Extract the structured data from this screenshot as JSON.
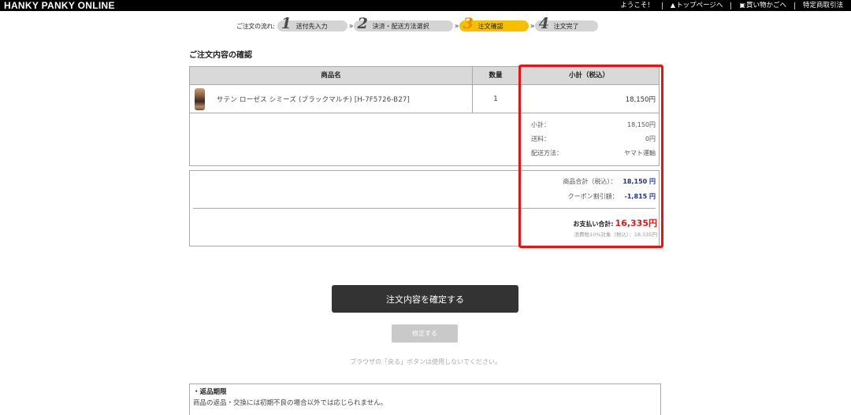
{
  "header": {
    "logo": "HANKY PANKY ONLINE",
    "nav": [
      {
        "label": "ようこそ！",
        "icon": ""
      },
      {
        "label": "トップページへ",
        "icon": "home-icon"
      },
      {
        "label": "買い物かごへ",
        "icon": "cart-icon"
      },
      {
        "label": "特定商取引法",
        "icon": ""
      }
    ]
  },
  "flow": {
    "label": "ご注文の流れ:",
    "steps": [
      {
        "num": "1",
        "label": "送付先入力",
        "active": false
      },
      {
        "num": "2",
        "label": "決済・配送方法選択",
        "active": false
      },
      {
        "num": "3",
        "label": "注文確認",
        "active": true
      },
      {
        "num": "4",
        "label": "注文完了",
        "active": false
      }
    ]
  },
  "section_title": "ご注文内容の確認",
  "table": {
    "headers": {
      "name": "商品名",
      "qty": "数量",
      "subtotal": "小計（税込）"
    },
    "rows": [
      {
        "name": "サテン ローゼス シミーズ (ブラックマルチ) [H-7F5726-B27]",
        "qty": "1",
        "subtotal": "18,150円"
      }
    ]
  },
  "summary": {
    "subtotal_label": "小計：",
    "subtotal_value": "18,150円",
    "shipping_label": "送料：",
    "shipping_value": "0円",
    "method_label": "配送方法：",
    "method_value": "ヤマト運輸"
  },
  "totals": {
    "goods_label": "商品合計（税込）：",
    "goods_value": "18,150 円",
    "coupon_label": "クーポン割引額：",
    "coupon_value": "-1,815 円",
    "grand_label": "お支払い合計:",
    "grand_value": "16,335円",
    "tax_note": "消費税10%対象（税込）：18,335円"
  },
  "buttons": {
    "confirm": "注文内容を確定する",
    "edit": "修正する"
  },
  "back_note": "ブラウザの「戻る」ボタンは使用しないでください。",
  "policy": {
    "title": "・返品期限",
    "text": "商品の返品・交換には初期不良の場合以外では応じられません。"
  },
  "colors": {
    "accent_step": "#f4c000",
    "highlight": "#ee1111",
    "total_red": "#e01818",
    "value_blue": "#1b2fa8",
    "confirm_button": "#333333"
  }
}
